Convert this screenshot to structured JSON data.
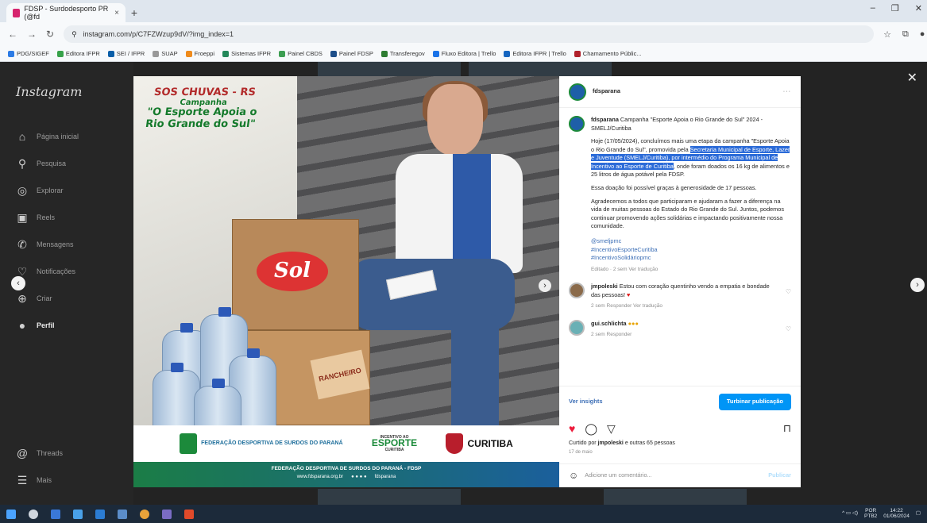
{
  "browser": {
    "tab_title": "FDSP - Surdodesporto PR (@fd",
    "tab_close": "×",
    "new_tab": "+",
    "url": "instagram.com/p/C7FZWzup9dV/?img_index=1",
    "bookmarks": [
      "PDG/SIGEF",
      "Editora IFPR",
      "SEI / IFPR",
      "SUAP",
      "Froeppi",
      "Sistemas IFPR",
      "Painel CBDS",
      "Painel FDSP",
      "Transferegov",
      "Fluxo Editora | Trello",
      "Editora IFPR | Trello",
      "Chamamento Públic..."
    ]
  },
  "sidebar": {
    "logo": "Instagram",
    "items": [
      {
        "label": "Página inicial",
        "icon": "home-icon"
      },
      {
        "label": "Pesquisa",
        "icon": "search-icon"
      },
      {
        "label": "Explorar",
        "icon": "compass-icon"
      },
      {
        "label": "Reels",
        "icon": "reels-icon"
      },
      {
        "label": "Mensagens",
        "icon": "messenger-icon"
      },
      {
        "label": "Notificações",
        "icon": "heart-icon"
      },
      {
        "label": "Criar",
        "icon": "plus-icon"
      },
      {
        "label": "Perfil",
        "icon": "profile-icon"
      }
    ],
    "threads": "Threads",
    "more": "Mais"
  },
  "image": {
    "sos_title": "SOS CHUVAS - RS",
    "campaign_word": "Campanha",
    "campaign_name": "\"O Esporte Apoia o Rio Grande do Sul\"",
    "box_brand": "Sol",
    "box2_brand": "RANCHEIRO",
    "fd_logo_text": "FEDERAÇÃO DESPORTIVA DE SURDOS DO PARANÁ",
    "esporte_small": "INCENTIVO AO",
    "esporte_big": "ESPORTE",
    "esporte_city": "CURITIBA",
    "curitiba": "CURITIBA",
    "footer_line": "FEDERAÇÃO DESPORTIVA DE SURDOS DO PARANÁ - FDSP",
    "footer_site": "www.fdsparana.org.br",
    "footer_handle": "fdsparana"
  },
  "post": {
    "username": "fdsparana",
    "more_dots": "···",
    "caption_title": "Campanha \"Esporte Apoia o Rio Grande do Sul\" 2024 - SMELJ/Curitiba",
    "p1_pre": "Hoje (17/05/2024), concluímos mais uma etapa da campanha \"Esporte Apoia o Rio Grande do Sul\", promovida pela ",
    "p1_hl": "Secretaria Municipal de Esporte, Lazer e Juventude (SMELJ/Curitiba), por intermédio do Programa Municipal de Incentivo ao Esporte de Curitiba",
    "p1_post": ", onde foram doados os 16 kg de alimentos e 25 litros de água potável pela FDSP.",
    "p2": "Essa doação foi possível graças à generosidade de 17 pessoas.",
    "p3": "Agradecemos a todos que participaram e ajudaram a fazer a diferença na vida de muitas pessoas do Estado do Rio Grande do Sul. Juntos, podemos continuar promovendo ações solidárias e impactando positivamente nossa comunidade.",
    "tags": [
      "@smeljpmc",
      "#IncentivoEsporteCuritiba",
      "#IncentivoSolidáriopmc"
    ],
    "caption_meta": "Editado · 2 sem   Ver tradução",
    "comments": [
      {
        "user": "jmpoleski",
        "text": "Estou com coração quentinho vendo a empatia e bondade das pessoas!",
        "meta": "2 sem   Responder   Ver tradução"
      },
      {
        "user": "gui.schlichta",
        "text": "",
        "meta": "2 sem   Responder"
      }
    ],
    "insights": "Ver insights",
    "boost": "Turbinar publicação",
    "liked_by_pre": "Curtido por ",
    "liked_by_user": "jmpoleski",
    "liked_by_post": " e outras 65 pessoas",
    "date": "17 de maio",
    "add_comment": "Adicione um comentário...",
    "publish": "Publicar"
  },
  "taskbar": {
    "lang": "POR",
    "lang2": "PTB2",
    "time": "14:22",
    "date": "01/06/2024"
  }
}
